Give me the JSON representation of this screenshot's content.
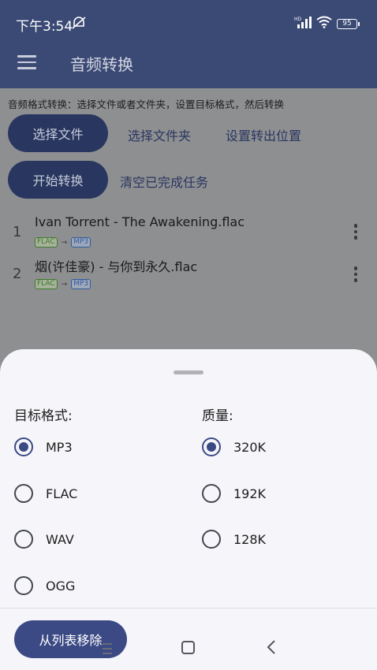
{
  "status_bar": {
    "time": "下午3:54",
    "battery": "95"
  },
  "app_bar": {
    "title": "音频转换"
  },
  "hint": "音频格式转换：选择文件或者文件夹，设置目标格式，然后转换",
  "actions": {
    "select_file": "选择文件",
    "select_folder": "选择文件夹",
    "set_output": "设置转出位置",
    "start": "开始转换",
    "clear_done": "清空已完成任务"
  },
  "files": [
    {
      "index": "1",
      "name": "Ivan Torrent - The Awakening.flac",
      "from": "FLAC",
      "to": "MP3"
    },
    {
      "index": "2",
      "name": "烟(许佳豪) - 与你到永久.flac",
      "from": "FLAC",
      "to": "MP3"
    }
  ],
  "sheet": {
    "format_label": "目标格式:",
    "quality_label": "质量:",
    "formats": [
      {
        "label": "MP3",
        "checked": true
      },
      {
        "label": "FLAC",
        "checked": false
      },
      {
        "label": "WAV",
        "checked": false
      },
      {
        "label": "OGG",
        "checked": false
      }
    ],
    "qualities": [
      {
        "label": "320K",
        "checked": true
      },
      {
        "label": "192K",
        "checked": false
      },
      {
        "label": "128K",
        "checked": false
      }
    ],
    "remove_button": "从列表移除"
  },
  "colors": {
    "primary": "#3b4a85",
    "app_bar": "#3b4a75",
    "sheet_bg": "#f6f6fa"
  }
}
